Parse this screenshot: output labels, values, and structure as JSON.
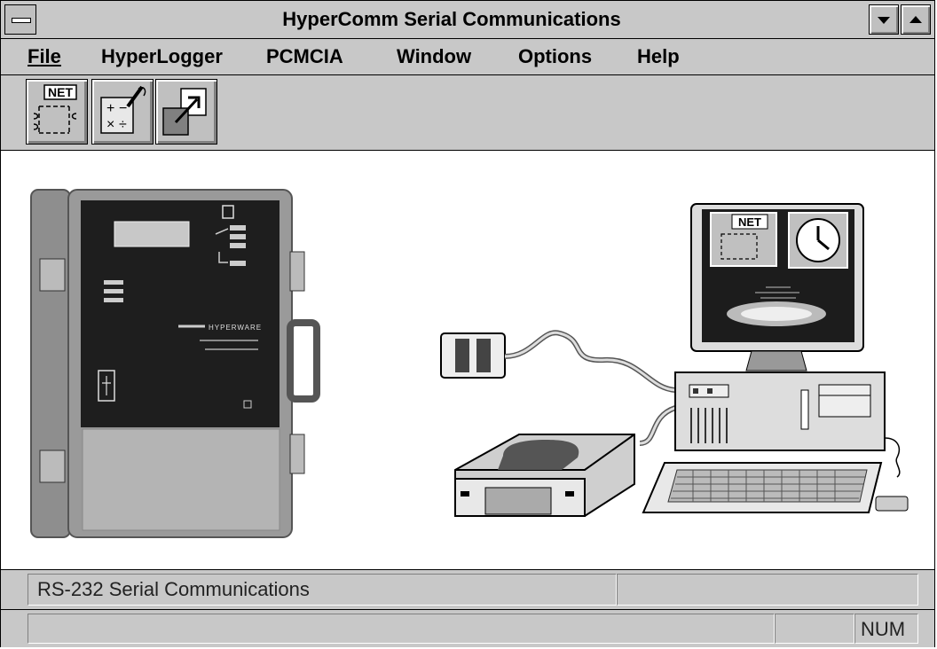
{
  "window": {
    "title": "HyperComm Serial Communications"
  },
  "menu": {
    "items": [
      "File",
      "HyperLogger",
      "PCMCIA",
      "Window",
      "Options",
      "Help"
    ]
  },
  "toolbar": {
    "tools": [
      {
        "label": "NET",
        "icon": "network-icon"
      },
      {
        "label": "",
        "icon": "calculator-icon"
      },
      {
        "label": "",
        "icon": "export-window-icon"
      }
    ]
  },
  "illustration": {
    "logger_brand_text": "HYPERWARE",
    "monitor_badge": "NET"
  },
  "status": {
    "message": "RS-232 Serial Communications",
    "secondary": "",
    "bottom_left": "",
    "bottom_mid": "",
    "indicator": "NUM"
  },
  "colors": {
    "chrome": "#c8c8c8",
    "border": "#000000",
    "workspace": "#ffffff",
    "device_case": "#9a9a9a",
    "device_panel": "#1e1e1e"
  }
}
